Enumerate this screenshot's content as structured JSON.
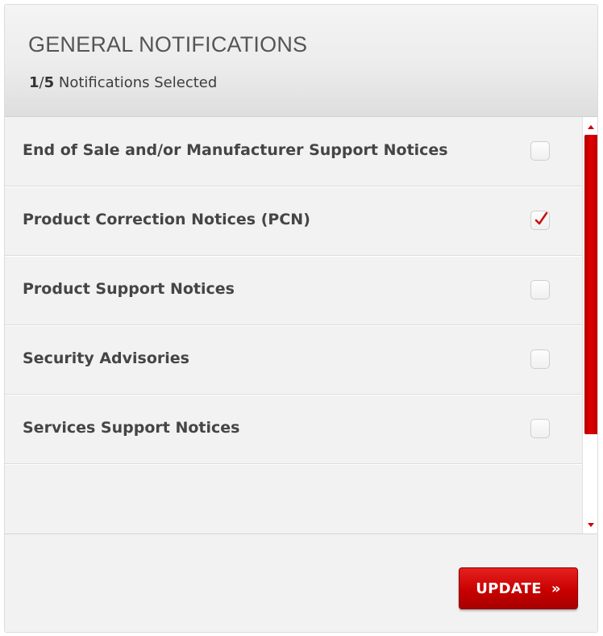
{
  "header": {
    "title": "GENERAL NOTIFICATIONS",
    "selected_count": "1",
    "total_count": "5",
    "selected_suffix": "Notifications Selected"
  },
  "notifications": [
    {
      "label": "End of Sale and/or Manufacturer Support Notices",
      "checked": false
    },
    {
      "label": "Product Correction Notices (PCN)",
      "checked": true
    },
    {
      "label": "Product Support Notices",
      "checked": false
    },
    {
      "label": "Security Advisories",
      "checked": false
    },
    {
      "label": "Services Support Notices",
      "checked": false
    }
  ],
  "scrollbar": {
    "position": 0.0,
    "visible_fraction": 0.96
  },
  "footer": {
    "update_label": "UPDATE",
    "update_chevron": "»"
  },
  "colors": {
    "accent": "#cc0000",
    "check_mark": "#cc1010",
    "title_text": "#555555"
  },
  "icons": {
    "checkmark": "check-icon",
    "update_arrow": "double-chevron-right-icon"
  }
}
